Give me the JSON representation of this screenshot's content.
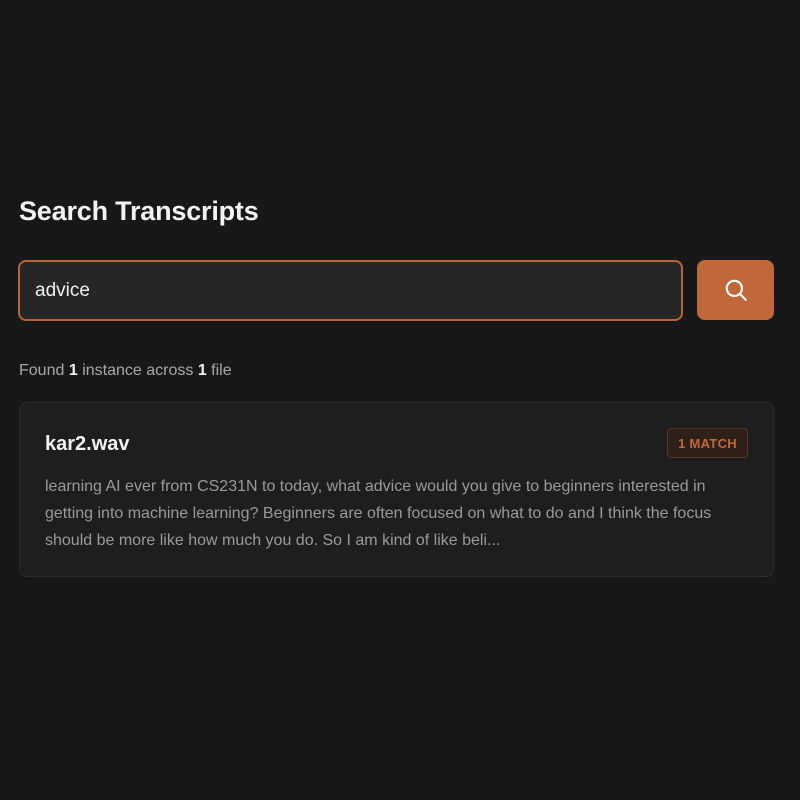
{
  "page": {
    "title": "Search Transcripts"
  },
  "search": {
    "value": "advice",
    "button_icon": "search-icon"
  },
  "summary": {
    "prefix": "Found",
    "instance_count": "1",
    "middle": "instance across",
    "file_count": "1",
    "suffix": "file"
  },
  "results": [
    {
      "file_name": "kar2.wav",
      "badge": "1 MATCH",
      "snippet": "learning AI ever from CS231N to today, what advice would you give to beginners interested in getting into machine learning? Beginners are often focused on what to do and I think the focus should be more like how much you do. So I am kind of like beli..."
    }
  ],
  "colors": {
    "background": "#181818",
    "accent": "#c0683a",
    "card": "#1e1e1e",
    "muted_text": "#9a9a9a"
  }
}
